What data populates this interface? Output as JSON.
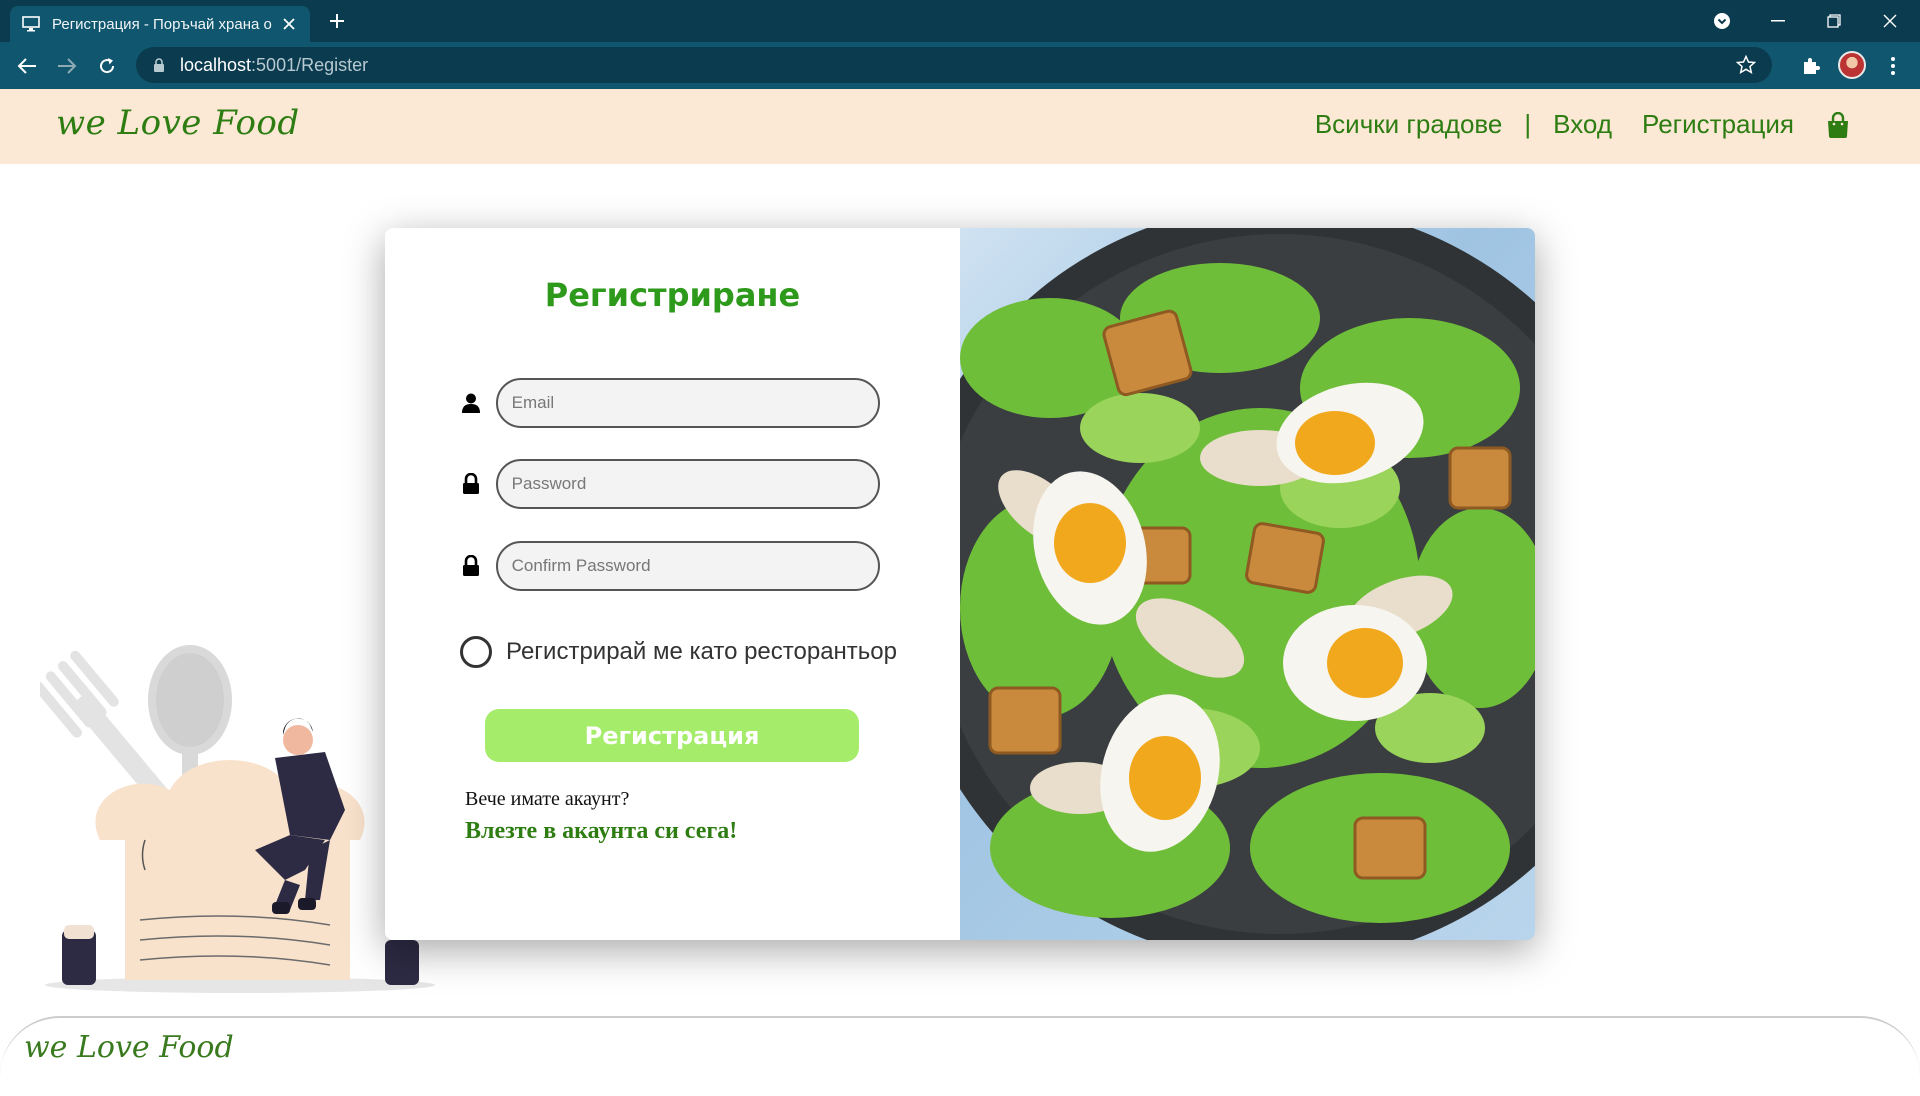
{
  "browser": {
    "tab_title": "Регистрация - Поръчай храна о",
    "url_host": "localhost",
    "url_path": ":5001/Register"
  },
  "header": {
    "logo": "we Love Food",
    "nav": {
      "all_cities": "Всички градове",
      "separator": "|",
      "login": "Вход",
      "register": "Регистрация"
    }
  },
  "form": {
    "title": "Регистриране",
    "email_placeholder": "Email",
    "password_placeholder": "Password",
    "confirm_placeholder": "Confirm Password",
    "restaurateur_label": "Регистрирай ме като ресторантьор",
    "restaurateur_checked": false,
    "submit_label": "Регистрация",
    "have_account": "Вече имате акаунт?",
    "login_link": "Влезте в акаунта си сега!"
  },
  "footer": {
    "logo": "we Love Food"
  },
  "colors": {
    "brand_green": "#2e7d12",
    "title_green": "#2e9a1c",
    "submit_green": "#a5ec6a",
    "header_bg": "#fbe9d6",
    "chrome_dark": "#0b3b4e",
    "chrome_tab": "#0f566e"
  },
  "icons": [
    "monitor-icon",
    "close-icon",
    "plus-icon",
    "back-icon",
    "forward-icon",
    "reload-icon",
    "lock-icon",
    "star-icon",
    "puzzle-icon",
    "menu-dots-icon",
    "shopping-bag-icon",
    "user-icon",
    "padlock-icon"
  ]
}
